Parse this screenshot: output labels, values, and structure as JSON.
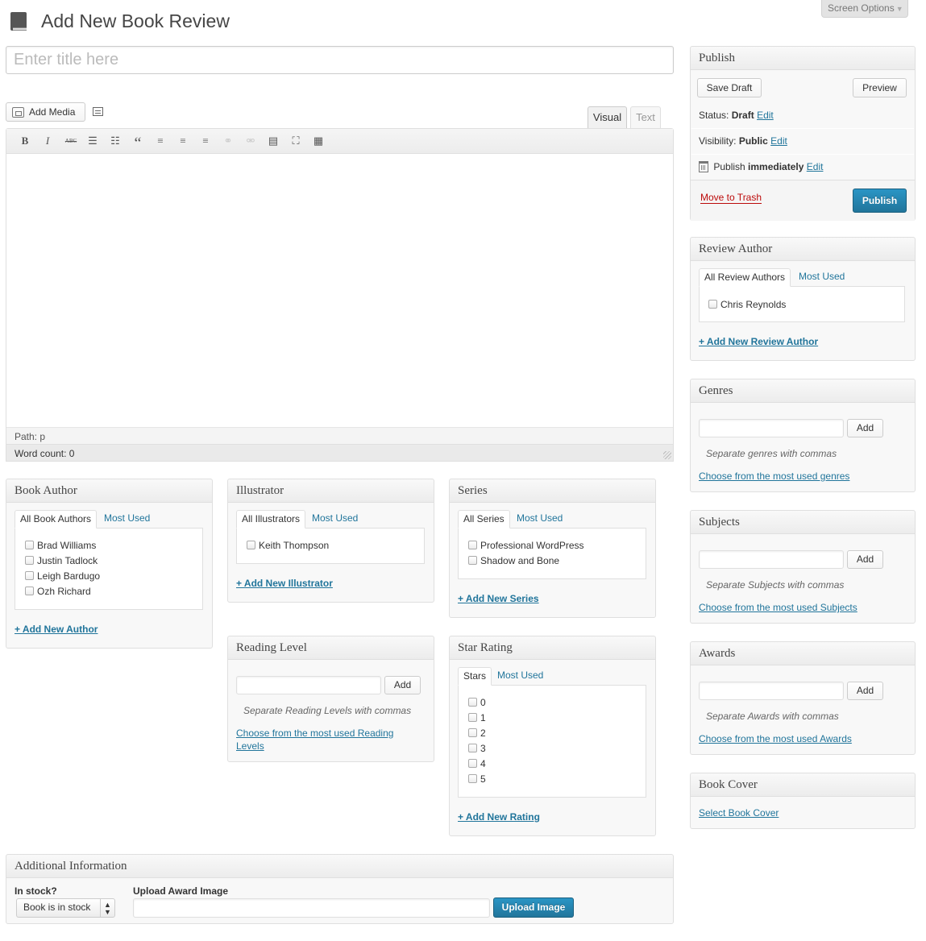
{
  "header": {
    "page_title": "Add New Book Review",
    "screen_options": "Screen Options",
    "title_placeholder": "Enter title here"
  },
  "editor": {
    "add_media": "Add Media",
    "tab_visual": "Visual",
    "tab_text": "Text",
    "toolbar": [
      {
        "name": "bold",
        "glyph": "B"
      },
      {
        "name": "italic",
        "glyph": "I"
      },
      {
        "name": "strikethrough",
        "glyph": "ABC"
      },
      {
        "name": "bullet-list",
        "glyph": "☰"
      },
      {
        "name": "numbered-list",
        "glyph": "☷"
      },
      {
        "name": "blockquote",
        "glyph": "“"
      },
      {
        "name": "align-left",
        "glyph": "≡"
      },
      {
        "name": "align-center",
        "glyph": "≡"
      },
      {
        "name": "align-right",
        "glyph": "≡"
      },
      {
        "name": "insert-link",
        "glyph": "⚭"
      },
      {
        "name": "remove-link",
        "glyph": "⚮"
      },
      {
        "name": "read-more",
        "glyph": "▤"
      },
      {
        "name": "fullscreen",
        "glyph": "⛶"
      },
      {
        "name": "kitchen-sink",
        "glyph": "▦"
      }
    ],
    "path": "Path: p",
    "word_count": "Word count: 0"
  },
  "publish": {
    "title": "Publish",
    "save_draft": "Save Draft",
    "preview": "Preview",
    "status_label": "Status:",
    "status_value": "Draft",
    "visibility_label": "Visibility:",
    "visibility_value": "Public",
    "publish_label": "Publish",
    "publish_value": "immediately",
    "edit": "Edit",
    "move_to_trash": "Move to Trash",
    "publish_button": "Publish"
  },
  "review_author": {
    "title": "Review Author",
    "tab_all": "All Review Authors",
    "tab_most_used": "Most Used",
    "items": [
      "Chris Reynolds"
    ],
    "add_new": "+ Add New Review Author"
  },
  "genres": {
    "title": "Genres",
    "add": "Add",
    "howto": "Separate genres with commas",
    "most_used": "Choose from the most used genres"
  },
  "subjects": {
    "title": "Subjects",
    "add": "Add",
    "howto": "Separate Subjects with commas",
    "most_used": "Choose from the most used Subjects"
  },
  "awards": {
    "title": "Awards",
    "add": "Add",
    "howto": "Separate Awards with commas",
    "most_used": "Choose from the most used Awards"
  },
  "book_cover": {
    "title": "Book Cover",
    "select": "Select Book Cover"
  },
  "book_author": {
    "title": "Book Author",
    "tab_all": "All Book Authors",
    "tab_most_used": "Most Used",
    "items": [
      "Brad Williams",
      "Justin Tadlock",
      "Leigh Bardugo",
      "Ozh Richard"
    ],
    "add_new": "+ Add New Author"
  },
  "illustrator": {
    "title": "Illustrator",
    "tab_all": "All Illustrators",
    "tab_most_used": "Most Used",
    "items": [
      "Keith Thompson"
    ],
    "add_new": "+ Add New Illustrator"
  },
  "series": {
    "title": "Series",
    "tab_all": "All Series",
    "tab_most_used": "Most Used",
    "items": [
      "Professional WordPress",
      "Shadow and Bone"
    ],
    "add_new": "+ Add New Series"
  },
  "reading_level": {
    "title": "Reading Level",
    "add": "Add",
    "howto": "Separate Reading Levels with commas",
    "most_used_line1": "Choose from the most used Reading",
    "most_used_line2": "Levels"
  },
  "star_rating": {
    "title": "Star Rating",
    "tab_all": "Stars",
    "tab_most_used": "Most Used",
    "items": [
      "0",
      "1",
      "2",
      "3",
      "4",
      "5"
    ],
    "add_new": "+ Add New Rating"
  },
  "additional": {
    "title": "Additional Information",
    "in_stock_label": "In stock?",
    "in_stock_value": "Book is in stock",
    "upload_label": "Upload Award Image",
    "upload_value": "",
    "upload_button": "Upload Image"
  },
  "colors": {
    "link": "#21759b",
    "primary_button": "#21759b",
    "trash": "#bc0b0b"
  }
}
